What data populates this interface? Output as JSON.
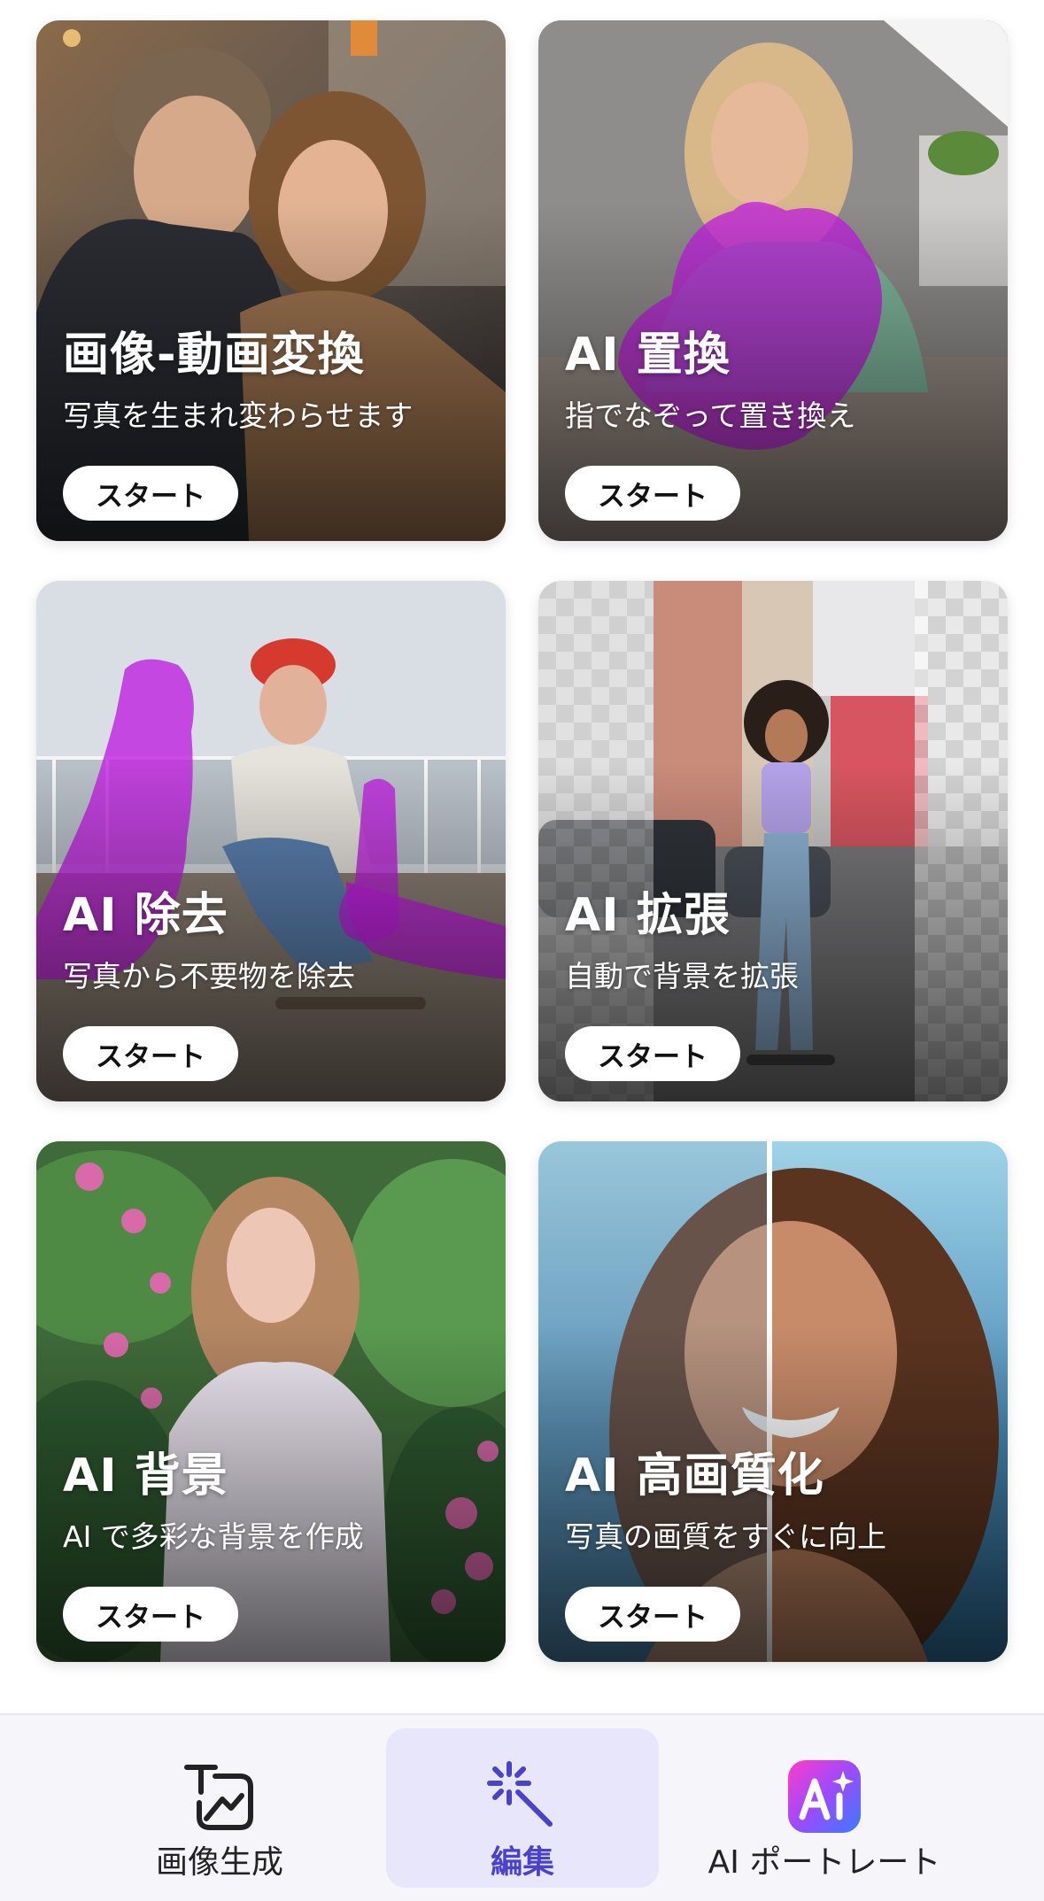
{
  "cards": [
    {
      "title": "画像-動画変換",
      "subtitle": "写真を生まれ変わらせます",
      "button": "スタート"
    },
    {
      "title": "AI 置換",
      "subtitle": "指でなぞって置き換え",
      "button": "スタート"
    },
    {
      "title": "AI 除去",
      "subtitle": "写真から不要物を除去",
      "button": "スタート"
    },
    {
      "title": "AI 拡張",
      "subtitle": "自動で背景を拡張",
      "button": "スタート"
    },
    {
      "title": "AI 背景",
      "subtitle": "AI で多彩な背景を作成",
      "button": "スタート"
    },
    {
      "title": "AI 高画質化",
      "subtitle": "写真の画質をすぐに向上",
      "button": "スタート"
    }
  ],
  "bottom_nav": {
    "items": [
      {
        "label": "画像生成",
        "icon": "text-to-image-icon",
        "active": false
      },
      {
        "label": "編集",
        "icon": "magic-wand-icon",
        "active": true
      },
      {
        "label": "AI ポートレート",
        "icon": "ai-portrait-app-icon",
        "active": false
      }
    ]
  },
  "colors": {
    "active_tab_bg": "#e7e6fb",
    "active_tab_text": "#4a42c9",
    "selection_overlay": "#c020e0",
    "button_bg": "#ffffff"
  }
}
